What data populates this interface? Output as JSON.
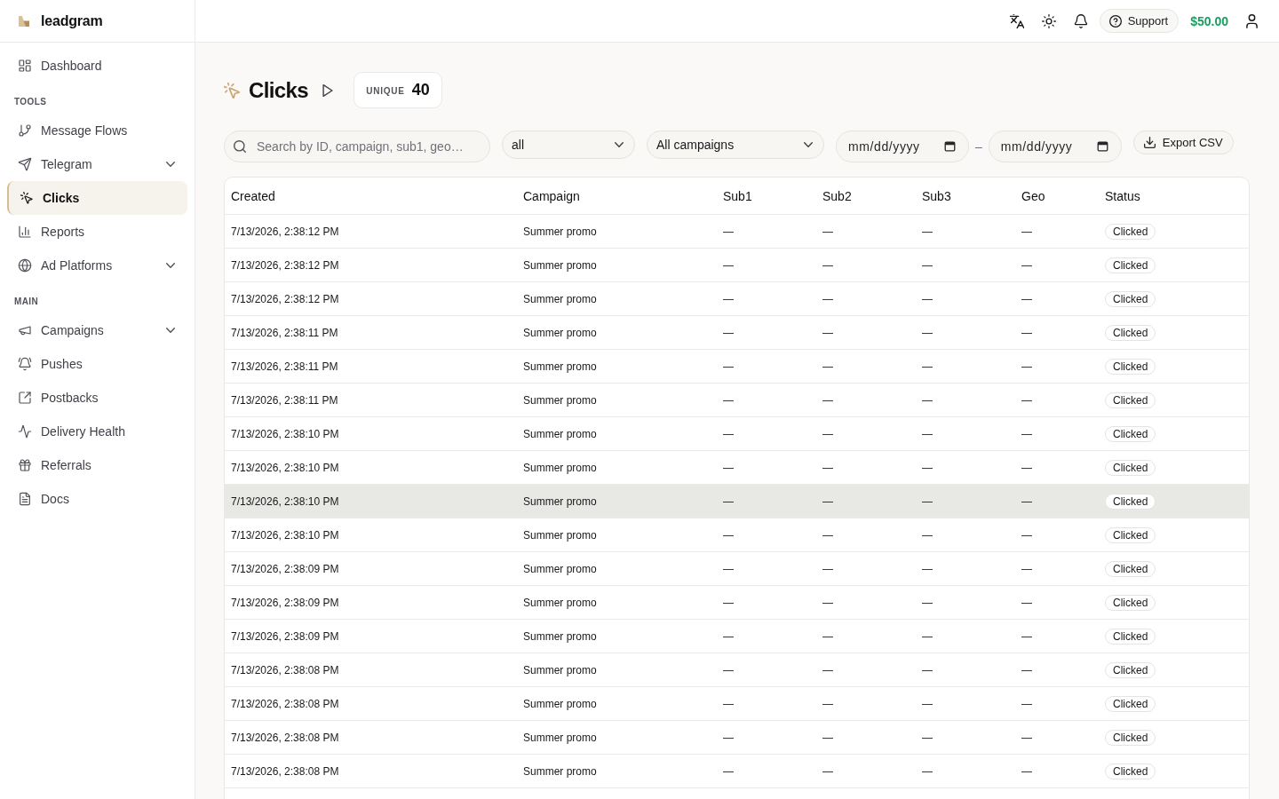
{
  "sidebar": {
    "brand": "leadgram",
    "items": [
      {
        "label": "Dashboard",
        "expandable": false,
        "selected": false
      }
    ],
    "sections": [
      {
        "heading": "TOOLS",
        "items": [
          {
            "label": "Message Flows",
            "expandable": false,
            "selected": false
          },
          {
            "label": "Telegram",
            "expandable": true,
            "selected": false
          },
          {
            "label": "Clicks",
            "expandable": false,
            "selected": true
          },
          {
            "label": "Reports",
            "expandable": false,
            "selected": false
          },
          {
            "label": "Ad Platforms",
            "expandable": true,
            "selected": false
          }
        ]
      },
      {
        "heading": "MAIN",
        "items": [
          {
            "label": "Campaigns",
            "expandable": true,
            "selected": false
          },
          {
            "label": "Pushes",
            "expandable": false,
            "selected": false
          },
          {
            "label": "Postbacks",
            "expandable": false,
            "selected": false
          },
          {
            "label": "Delivery Health",
            "expandable": false,
            "selected": false
          },
          {
            "label": "Referrals",
            "expandable": false,
            "selected": false
          },
          {
            "label": "Docs",
            "expandable": false,
            "selected": false
          }
        ]
      }
    ]
  },
  "top_bar": {
    "support_button": "Support",
    "balance": "$50.00"
  },
  "page": {
    "title": "Clicks",
    "unique": {
      "label": "UNIQUE",
      "value": "40"
    }
  },
  "filters": {
    "search": {
      "placeholder": "Search by ID, campaign, sub1, geo…"
    },
    "status_select": {
      "value": "all"
    },
    "campaign_select": {
      "value": "All campaigns"
    },
    "date_from": {
      "placeholder": "mm/dd/yyyy"
    },
    "date_separator": "–",
    "date_to": {
      "placeholder": "mm/dd/yyyy"
    },
    "export_button": "Export CSV"
  },
  "table": {
    "columns": [
      {
        "label": "Created",
        "kind": "text"
      },
      {
        "label": "Campaign",
        "kind": "text"
      },
      {
        "label": "Sub1",
        "kind": "text"
      },
      {
        "label": "Sub2",
        "kind": "text"
      },
      {
        "label": "Sub3",
        "kind": "text"
      },
      {
        "label": "Geo",
        "kind": "text"
      },
      {
        "label": "Status",
        "kind": "badge"
      }
    ],
    "rows": [
      {
        "cells": [
          "7/13/2026, 2:38:12 PM",
          "Summer promo",
          "—",
          "—",
          "—",
          "—",
          "Clicked"
        ],
        "selected": false
      },
      {
        "cells": [
          "7/13/2026, 2:38:12 PM",
          "Summer promo",
          "—",
          "—",
          "—",
          "—",
          "Clicked"
        ],
        "selected": false
      },
      {
        "cells": [
          "7/13/2026, 2:38:12 PM",
          "Summer promo",
          "—",
          "—",
          "—",
          "—",
          "Clicked"
        ],
        "selected": false
      },
      {
        "cells": [
          "7/13/2026, 2:38:11 PM",
          "Summer promo",
          "—",
          "—",
          "—",
          "—",
          "Clicked"
        ],
        "selected": false
      },
      {
        "cells": [
          "7/13/2026, 2:38:11 PM",
          "Summer promo",
          "—",
          "—",
          "—",
          "—",
          "Clicked"
        ],
        "selected": false
      },
      {
        "cells": [
          "7/13/2026, 2:38:11 PM",
          "Summer promo",
          "—",
          "—",
          "—",
          "—",
          "Clicked"
        ],
        "selected": false
      },
      {
        "cells": [
          "7/13/2026, 2:38:10 PM",
          "Summer promo",
          "—",
          "—",
          "—",
          "—",
          "Clicked"
        ],
        "selected": false
      },
      {
        "cells": [
          "7/13/2026, 2:38:10 PM",
          "Summer promo",
          "—",
          "—",
          "—",
          "—",
          "Clicked"
        ],
        "selected": false
      },
      {
        "cells": [
          "7/13/2026, 2:38:10 PM",
          "Summer promo",
          "—",
          "—",
          "—",
          "—",
          "Clicked"
        ],
        "selected": true
      },
      {
        "cells": [
          "7/13/2026, 2:38:10 PM",
          "Summer promo",
          "—",
          "—",
          "—",
          "—",
          "Clicked"
        ],
        "selected": false
      },
      {
        "cells": [
          "7/13/2026, 2:38:09 PM",
          "Summer promo",
          "—",
          "—",
          "—",
          "—",
          "Clicked"
        ],
        "selected": false
      },
      {
        "cells": [
          "7/13/2026, 2:38:09 PM",
          "Summer promo",
          "—",
          "—",
          "—",
          "—",
          "Clicked"
        ],
        "selected": false
      },
      {
        "cells": [
          "7/13/2026, 2:38:09 PM",
          "Summer promo",
          "—",
          "—",
          "—",
          "—",
          "Clicked"
        ],
        "selected": false
      },
      {
        "cells": [
          "7/13/2026, 2:38:08 PM",
          "Summer promo",
          "—",
          "—",
          "—",
          "—",
          "Clicked"
        ],
        "selected": false
      },
      {
        "cells": [
          "7/13/2026, 2:38:08 PM",
          "Summer promo",
          "—",
          "—",
          "—",
          "—",
          "Clicked"
        ],
        "selected": false
      },
      {
        "cells": [
          "7/13/2026, 2:38:08 PM",
          "Summer promo",
          "—",
          "—",
          "—",
          "—",
          "Clicked"
        ],
        "selected": false
      },
      {
        "cells": [
          "7/13/2026, 2:38:08 PM",
          "Summer promo",
          "—",
          "—",
          "—",
          "—",
          "Clicked"
        ],
        "selected": false
      }
    ]
  }
}
